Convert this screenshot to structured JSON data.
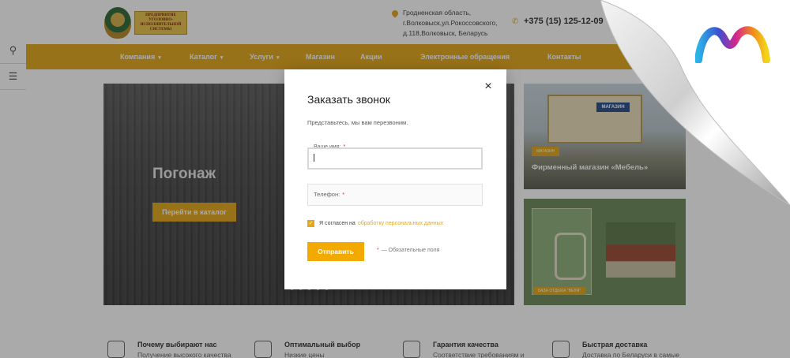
{
  "header": {
    "logo_text": "ПРЕДПРИЯТИЕ УГОЛОВНО-ИСПОЛНИТЕЛЬНОЙ СИСТЕМЫ",
    "address_line1": "Гродненская область,",
    "address_line2": "г.Волковыск,ул.Рокоссовского,",
    "address_line3": "д.118,Волковыск, Беларусь",
    "phone": "+375 (15) 125-12-09"
  },
  "nav": {
    "items": [
      {
        "label": "Компания",
        "caret": "▾"
      },
      {
        "label": "Каталог",
        "caret": "▾"
      },
      {
        "label": "Услуги",
        "caret": "▾"
      },
      {
        "label": "Магазин"
      },
      {
        "label": "Акции"
      },
      {
        "label": "Электронные обращения"
      },
      {
        "label": "Контакты"
      }
    ]
  },
  "slider": {
    "title": "Погонаж",
    "button": "Перейти в каталог",
    "dot_count": 5,
    "active_dot": 4
  },
  "cards": [
    {
      "sign": "МАГАЗИН",
      "tag": "МАГАЗИН",
      "title": "Фирменный магазин «Мебель»"
    },
    {
      "tag": "БАЗА ОТДЫХА \"ВЕЛЯ\""
    }
  ],
  "features": [
    {
      "title": "Почему выбирают нас",
      "sub": "Получение высокого качества"
    },
    {
      "title": "Оптимальный выбор",
      "sub": "Низкие цены"
    },
    {
      "title": "Гарантия качества",
      "sub": "Соответствие требованиям и"
    },
    {
      "title": "Быстрая доставка",
      "sub": "Доставка по Беларуси в самые"
    }
  ],
  "modal": {
    "title": "Заказать звонок",
    "subtitle": "Представьтесь, мы вам перезвоним.",
    "close": "×",
    "name_label": "Ваше имя:",
    "phone_label": "Телефон:",
    "required_mark": "*",
    "agree_text": "Я согласен на",
    "agree_link": "обработку персональных данных",
    "checkbox_checked": true,
    "checkbox_mark": "✓",
    "submit": "Отправить",
    "required_note": "— Обязательные поля"
  },
  "colors": {
    "accent": "#e3a81b",
    "button": "#f2a900",
    "required": "#d43a26"
  },
  "icons": {
    "side_tool_1": "compare-icon",
    "side_tool_2": "settings-sliders-icon",
    "phone": "phone-icon",
    "address": "location-pin-icon"
  }
}
